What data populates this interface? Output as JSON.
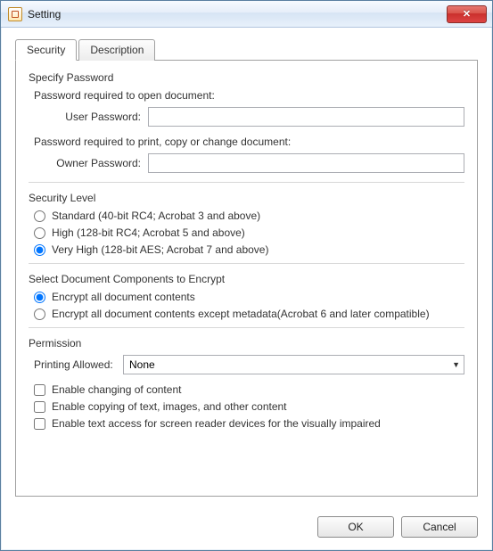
{
  "window": {
    "title": "Setting"
  },
  "tabs": {
    "security": "Security",
    "description": "Description"
  },
  "specify_password": {
    "title": "Specify Password",
    "open_hint": "Password required to open document:",
    "user_label": "User Password:",
    "user_value": "",
    "change_hint": "Password required to print, copy or change document:",
    "owner_label": "Owner Password:",
    "owner_value": ""
  },
  "security_level": {
    "title": "Security Level",
    "standard": "Standard (40-bit RC4; Acrobat 3 and above)",
    "high": "High (128-bit RC4; Acrobat 5 and above)",
    "veryhigh": "Very High (128-bit AES; Acrobat 7 and above)",
    "selected": "veryhigh"
  },
  "encrypt": {
    "title": "Select Document Components to Encrypt",
    "all": "Encrypt all document contents",
    "except_meta": "Encrypt all document contents except metadata(Acrobat 6 and later compatible)",
    "selected": "all"
  },
  "permission": {
    "title": "Permission",
    "printing_label": "Printing Allowed:",
    "printing_value": "None",
    "enable_changing": "Enable changing of content",
    "enable_copying": "Enable copying of text, images, and other content",
    "enable_text_access": "Enable text access for screen reader devices for the visually impaired"
  },
  "buttons": {
    "ok": "OK",
    "cancel": "Cancel"
  }
}
